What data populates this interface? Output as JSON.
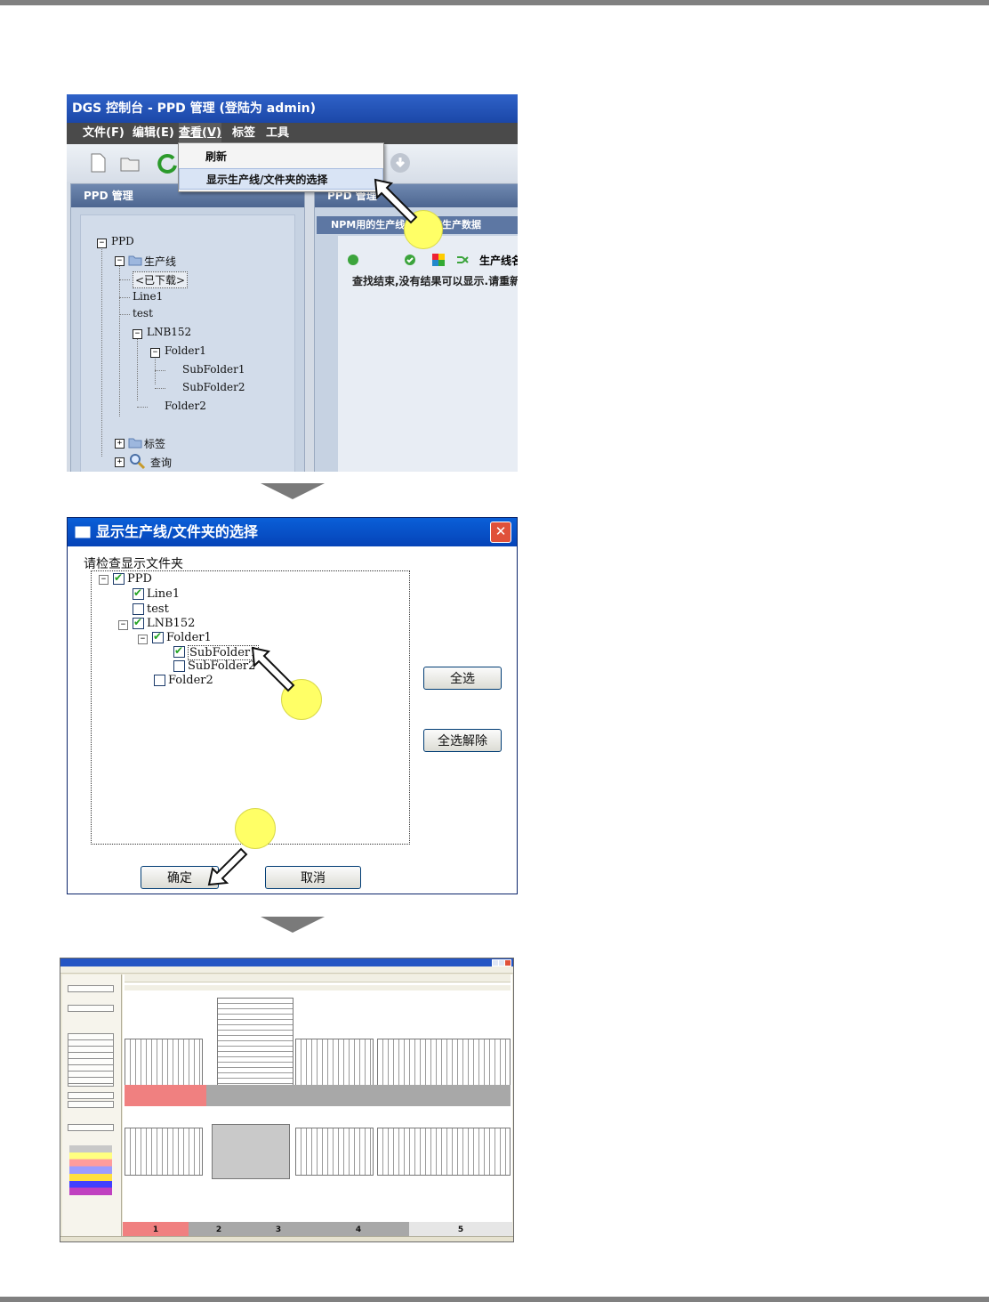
{
  "screenshot1": {
    "title": "DGS 控制台 - PPD 管理 (登陆为 admin)",
    "menu": [
      "文件(F)",
      "编辑(E)",
      "查看(V)",
      "标签",
      "工具"
    ],
    "dropdown": [
      "刷新",
      "显示生产线/文件夹的选择"
    ],
    "left_panel_title": "PPD 管理",
    "tree": {
      "root": "PPD",
      "production_lines": "生产线",
      "downloaded": "<已下载>",
      "line1": "Line1",
      "test": "test",
      "lnb152": "LNB152",
      "folder1": "Folder1",
      "subfolder1": "SubFolder1",
      "subfolder2": "SubFolder2",
      "folder2": "Folder2",
      "tags": "标签",
      "query": "查询"
    },
    "right_panel_title": "PPD 管理",
    "tab_label": "NPM用的生产线     SP用的生产数据",
    "column_header": "生产线名",
    "result_message": "查找结束,没有结果可以显示.请重新"
  },
  "screenshot2": {
    "title": "显示生产线/文件夹的选择",
    "close_label": "✕",
    "prompt": "请检查显示文件夹",
    "tree": [
      {
        "label": "PPD",
        "checked": true
      },
      {
        "label": "Line1",
        "checked": true
      },
      {
        "label": "test",
        "checked": false
      },
      {
        "label": "LNB152",
        "checked": true
      },
      {
        "label": "Folder1",
        "checked": true
      },
      {
        "label": "SubFolder1",
        "checked": true
      },
      {
        "label": "SubFolder2",
        "checked": false
      },
      {
        "label": "Folder2",
        "checked": false
      }
    ],
    "select_all": "全选",
    "deselect_all": "全选解除",
    "ok": "确定",
    "cancel": "取消"
  },
  "screenshot3": {
    "bottom_tabs": [
      "1",
      "2",
      "3",
      "4",
      "5"
    ],
    "accent_colors": {
      "highlight_red": "#f08080",
      "band_gray": "#a8a8a8",
      "title_blue": "#2455c4"
    }
  }
}
